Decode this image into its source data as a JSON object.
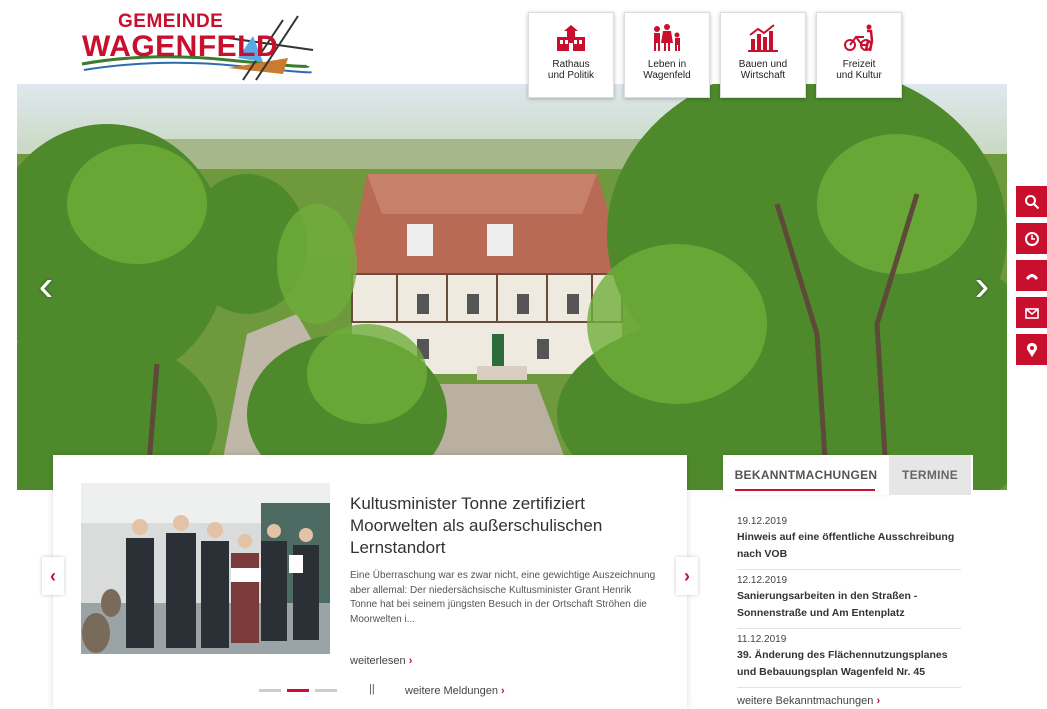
{
  "logo": {
    "line1": "GEMEINDE",
    "line2": "WAGENFELD"
  },
  "nav": [
    {
      "label": "Rathaus\nund Politik",
      "icon": "town-hall-icon"
    },
    {
      "label": "Leben in\nWagenfeld",
      "icon": "family-icon"
    },
    {
      "label": "Bauen und\nWirtschaft",
      "icon": "bar-chart-icon"
    },
    {
      "label": "Freizeit\nund Kultur",
      "icon": "cyclist-icon"
    }
  ],
  "hero": {
    "prev": "‹",
    "next": "›"
  },
  "sidetools": [
    "search-icon",
    "clock-icon",
    "phone-icon",
    "mail-icon",
    "location-pin-icon"
  ],
  "news": {
    "title": "Kultusminister Tonne zertifiziert Moorwelten als außerschulischen Lernstandort",
    "text": "Eine Überraschung war es zwar nicht, eine gewichtige Auszeichnung aber allemal: Der niedersächsische Kultusminister Grant Henrik Tonne hat bei seinem jüngsten Besuch in der Ortschaft Ströhen die Moorwelten i...",
    "more": "weiterlesen",
    "more_chev": "›",
    "pause": "||",
    "all": "weitere Meldungen",
    "all_chev": "›",
    "prev": "‹",
    "next": "›",
    "slides_total": 3,
    "slide_active": 2
  },
  "announcements": {
    "tab1": "BEKANNTMACHUNGEN",
    "tab2": "TERMINE",
    "items": [
      {
        "date": "19.12.2019",
        "title": "Hinweis auf eine öffentliche Ausschreibung nach VOB"
      },
      {
        "date": "12.12.2019",
        "title": "Sanierungsarbeiten in den Straßen - Sonnenstraße und Am Entenplatz"
      },
      {
        "date": "11.12.2019",
        "title": "39. Änderung des Flächennutzungsplanes und Bebauungsplan Wagenfeld Nr. 45"
      }
    ],
    "more": "weitere Bekanntmachungen",
    "more_chev": "›"
  },
  "colors": {
    "accent": "#c8102e",
    "hero_green": "#6e9a3d"
  }
}
